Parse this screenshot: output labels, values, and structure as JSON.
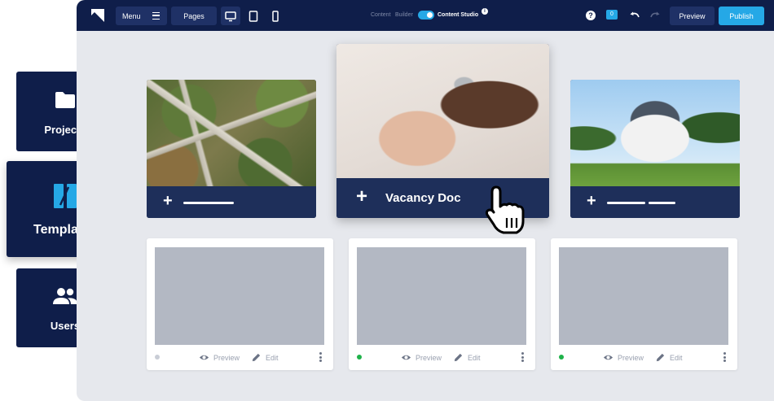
{
  "sidebar": {
    "items": [
      {
        "label": "Projects",
        "icon": "folder-icon"
      },
      {
        "label": "Templates",
        "icon": "templates-icon"
      },
      {
        "label": "Users",
        "icon": "users-icon"
      }
    ]
  },
  "topbar": {
    "menu_label": "Menu",
    "pages_label": "Pages",
    "mode_left_a": "Content",
    "mode_left_b": "Builder",
    "mode_right": "Content Studio",
    "comment_count": "0",
    "preview_label": "Preview",
    "publish_label": "Publish",
    "accent_color": "#25a8e6",
    "bar_color": "#0f1e4a"
  },
  "featured": {
    "card2_label": "Vacancy Doc"
  },
  "templates": [
    {
      "status_color": "#c9cdd6",
      "preview_label": "Preview",
      "edit_label": "Edit"
    },
    {
      "status_color": "#1fb24a",
      "preview_label": "Preview",
      "edit_label": "Edit"
    },
    {
      "status_color": "#1fb24a",
      "preview_label": "Preview",
      "edit_label": "Edit"
    }
  ]
}
